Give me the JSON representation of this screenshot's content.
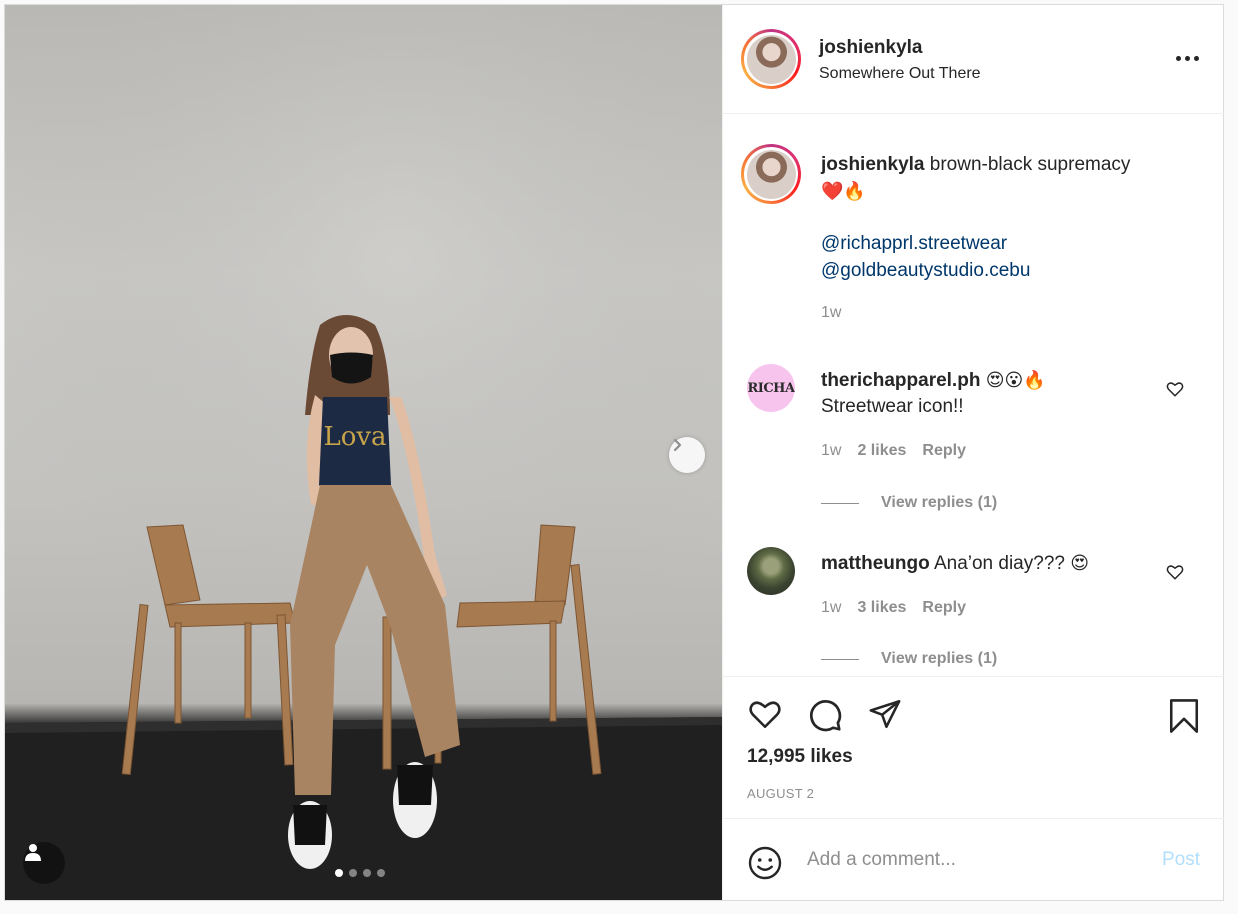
{
  "post": {
    "author": {
      "username": "joshienkyla",
      "location": "Somewhere Out There"
    },
    "caption": {
      "username": "joshienkyla",
      "text": "brown-black supremacy",
      "emojis": "❤️🔥",
      "mentions": [
        "@richapprl.streetwear",
        "@goldbeautystudio.cebu"
      ],
      "time": "1w"
    },
    "comments": [
      {
        "username": "therichapparel.ph",
        "avatar_text": "RICHA",
        "emojis": "😍😮🔥",
        "text": "Streetwear icon!!",
        "time": "1w",
        "likes": "2 likes",
        "reply_label": "Reply",
        "view_replies": "View replies (1)"
      },
      {
        "username": "mattheungo",
        "text": "Ana’on diay???",
        "emojis": "😍",
        "time": "1w",
        "likes": "3 likes",
        "reply_label": "Reply",
        "view_replies": "View replies (1)"
      }
    ],
    "likes": "12,995 likes",
    "date": "AUGUST 2",
    "comment_box": {
      "placeholder": "Add a comment...",
      "post_label": "Post"
    },
    "media": {
      "slide_count": 4,
      "active_slide": 1
    }
  },
  "icons": {
    "more": "more-options-icon",
    "like": "heart-icon",
    "comment": "comment-icon",
    "share": "paper-plane-icon",
    "save": "bookmark-icon",
    "emoji": "emoji-icon",
    "next": "chevron-right-icon",
    "tag": "user-tag-icon"
  },
  "colors": {
    "link": "#00376b",
    "muted": "#8e8e8e",
    "post_disabled": "#b2dffc",
    "border": "#dbdbdb"
  }
}
